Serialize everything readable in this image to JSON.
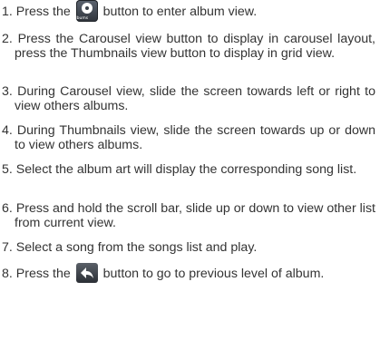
{
  "steps": [
    {
      "num": "1.",
      "before": "Press the ",
      "icon": "albums-icon",
      "icon_caption": "Albums",
      "after": " button to enter album view."
    },
    {
      "num": "2.",
      "text": "Press the Carousel view button to display in carousel layout, press the Thumbnails view button to display in grid view."
    },
    {
      "num": "3.",
      "text": "During Carousel view, slide the screen towards left or right to view others albums."
    },
    {
      "num": "4.",
      "text": "During Thumbnails view, slide the screen towards up or down to view others albums."
    },
    {
      "num": "5.",
      "text": "Select the album art will display the corresponding song list."
    },
    {
      "num": "6.",
      "text": "Press and hold the scroll bar, slide up or down to view other list from current view."
    },
    {
      "num": "7.",
      "text": "Select a song from the songs list and play."
    },
    {
      "num": "8.",
      "before": "Press the ",
      "icon": "back-arrow-icon",
      "after": " button to go to previous level of album."
    }
  ]
}
